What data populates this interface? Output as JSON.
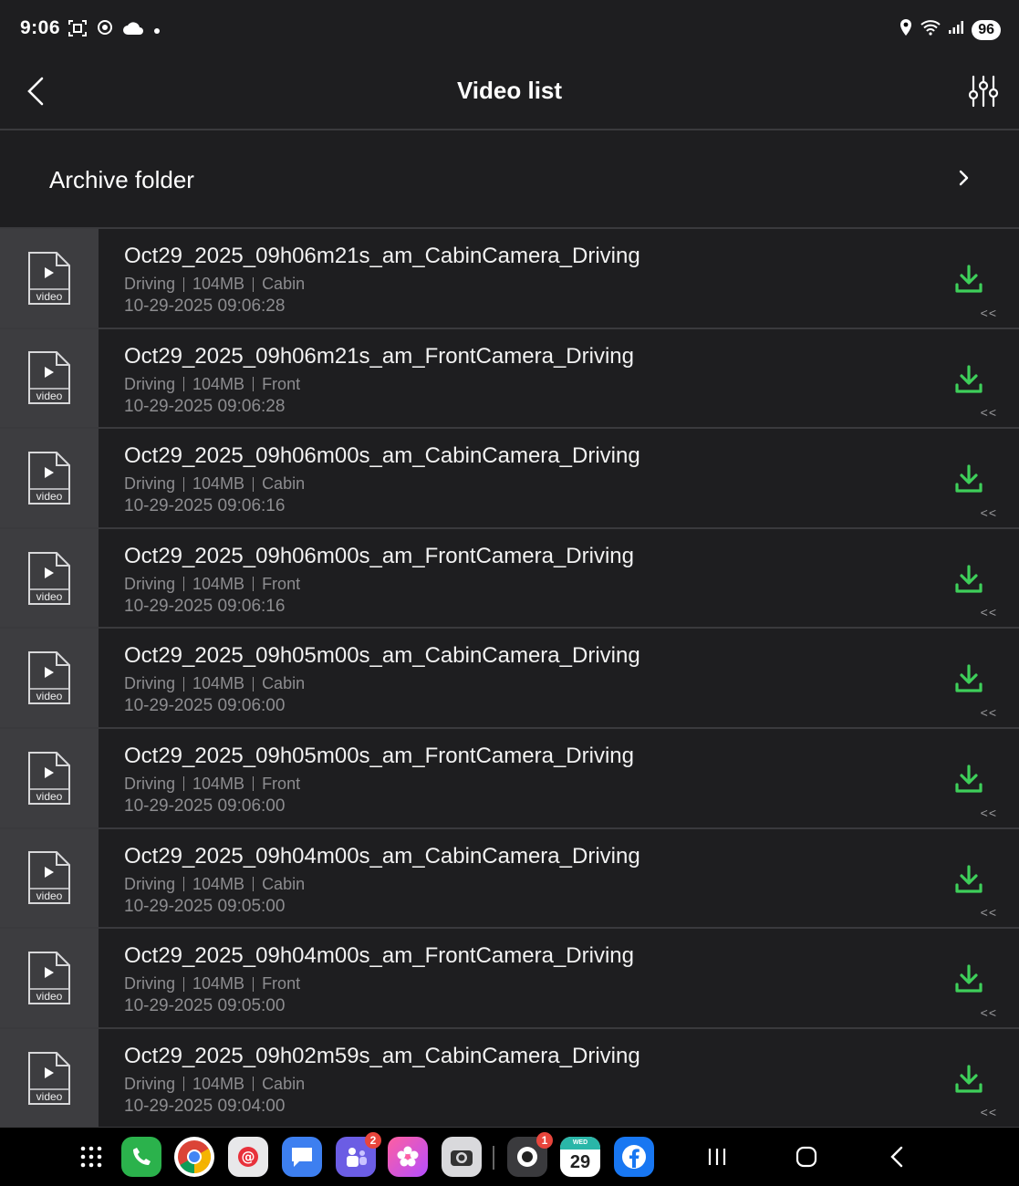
{
  "status_bar": {
    "time": "9:06",
    "battery": "96"
  },
  "header": {
    "title": "Video list"
  },
  "archive": {
    "label": "Archive folder"
  },
  "list": {
    "thumb_label": "video",
    "expand_label": "<<",
    "items": [
      {
        "title": "Oct29_2025_09h06m21s_am_CabinCamera_Driving",
        "type": "Driving",
        "size": "104MB",
        "camera": "Cabin",
        "datetime": "10-29-2025 09:06:28"
      },
      {
        "title": "Oct29_2025_09h06m21s_am_FrontCamera_Driving",
        "type": "Driving",
        "size": "104MB",
        "camera": "Front",
        "datetime": "10-29-2025 09:06:28"
      },
      {
        "title": "Oct29_2025_09h06m00s_am_CabinCamera_Driving",
        "type": "Driving",
        "size": "104MB",
        "camera": "Cabin",
        "datetime": "10-29-2025 09:06:16"
      },
      {
        "title": "Oct29_2025_09h06m00s_am_FrontCamera_Driving",
        "type": "Driving",
        "size": "104MB",
        "camera": "Front",
        "datetime": "10-29-2025 09:06:16"
      },
      {
        "title": "Oct29_2025_09h05m00s_am_CabinCamera_Driving",
        "type": "Driving",
        "size": "104MB",
        "camera": "Cabin",
        "datetime": "10-29-2025 09:06:00"
      },
      {
        "title": "Oct29_2025_09h05m00s_am_FrontCamera_Driving",
        "type": "Driving",
        "size": "104MB",
        "camera": "Front",
        "datetime": "10-29-2025 09:06:00"
      },
      {
        "title": "Oct29_2025_09h04m00s_am_CabinCamera_Driving",
        "type": "Driving",
        "size": "104MB",
        "camera": "Cabin",
        "datetime": "10-29-2025 09:05:00"
      },
      {
        "title": "Oct29_2025_09h04m00s_am_FrontCamera_Driving",
        "type": "Driving",
        "size": "104MB",
        "camera": "Front",
        "datetime": "10-29-2025 09:05:00"
      },
      {
        "title": "Oct29_2025_09h02m59s_am_CabinCamera_Driving",
        "type": "Driving",
        "size": "104MB",
        "camera": "Cabin",
        "datetime": "10-29-2025 09:04:00"
      }
    ]
  },
  "colors": {
    "accent_download": "#3ecf5a",
    "background": "#1e1e20",
    "thumb_bg": "#3d3d40",
    "meta_text": "#8d8d90"
  },
  "dock": {
    "teams_badge": "2",
    "camera_badge": "1",
    "calendar_day": "29",
    "calendar_weekday": "WED"
  }
}
